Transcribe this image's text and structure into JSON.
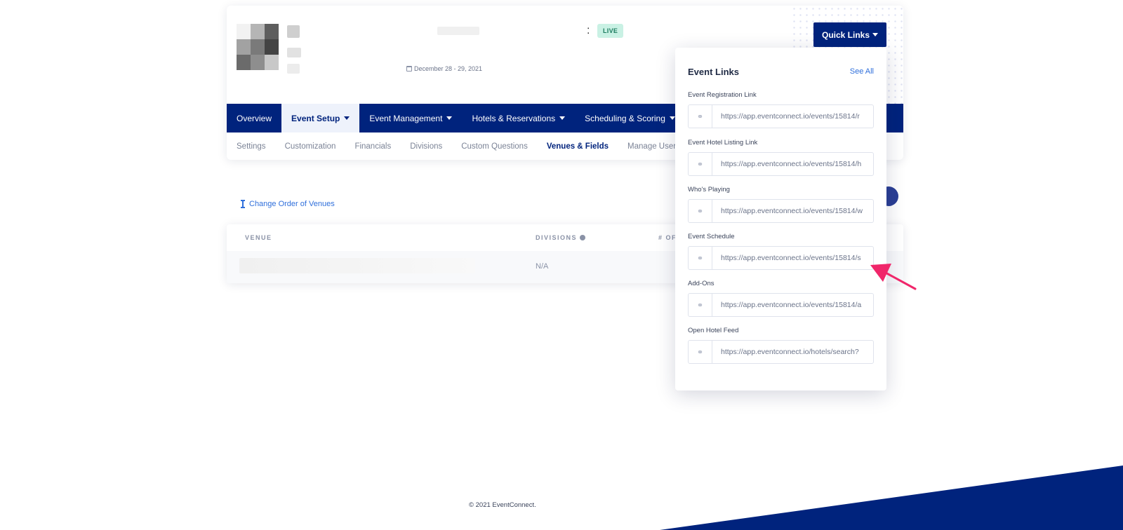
{
  "header": {
    "status_badge": "LIVE",
    "colon": ":",
    "date": "December 28 - 29, 2021",
    "quick_links_label": "Quick Links"
  },
  "nav": {
    "items": [
      {
        "label": "Overview",
        "has_dropdown": false,
        "active": false
      },
      {
        "label": "Event Setup",
        "has_dropdown": true,
        "active": true
      },
      {
        "label": "Event Management",
        "has_dropdown": true,
        "active": false
      },
      {
        "label": "Hotels & Reservations",
        "has_dropdown": true,
        "active": false
      },
      {
        "label": "Scheduling & Scoring",
        "has_dropdown": true,
        "active": false
      }
    ]
  },
  "subnav": {
    "items": [
      {
        "label": "Settings",
        "active": false
      },
      {
        "label": "Customization",
        "active": false
      },
      {
        "label": "Financials",
        "active": false
      },
      {
        "label": "Divisions",
        "active": false
      },
      {
        "label": "Custom Questions",
        "active": false
      },
      {
        "label": "Venues & Fields",
        "active": true
      },
      {
        "label": "Manage Users",
        "active": false
      }
    ]
  },
  "venues": {
    "change_order_label": "Change Order of Venues",
    "table": {
      "headers": [
        "VENUE",
        "DIVISIONS",
        "# OF"
      ],
      "rows": [
        {
          "venue": "",
          "divisions": "N/A"
        }
      ]
    }
  },
  "event_links": {
    "title": "Event Links",
    "see_all": "See All",
    "links": [
      {
        "label": "Event Registration Link",
        "url": "https://app.eventconnect.io/events/15814/r"
      },
      {
        "label": "Event Hotel Listing Link",
        "url": "https://app.eventconnect.io/events/15814/h"
      },
      {
        "label": "Who's Playing",
        "url": "https://app.eventconnect.io/events/15814/w"
      },
      {
        "label": "Event Schedule",
        "url": "https://app.eventconnect.io/events/15814/s"
      },
      {
        "label": "Add-Ons",
        "url": "https://app.eventconnect.io/events/15814/a"
      },
      {
        "label": "Open Hotel Feed",
        "url": "https://app.eventconnect.io/hotels/search?"
      }
    ]
  },
  "footer": {
    "copyright": "© 2021 EventConnect."
  },
  "colors": {
    "brand_navy": "#00237d",
    "accent_blue": "#2f6fdb",
    "live_badge_bg": "#c9f1e4",
    "arrow_pink": "#f0266a"
  }
}
